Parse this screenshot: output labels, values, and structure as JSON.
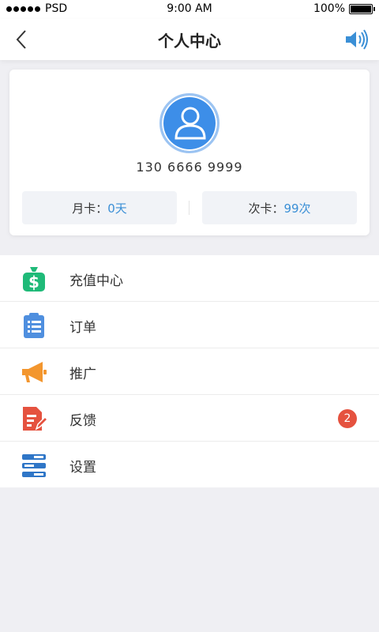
{
  "status_bar": {
    "carrier": "PSD",
    "time": "9:00 AM",
    "battery": "100%",
    "battery_level": 1.0
  },
  "nav": {
    "title": "个人中心",
    "back_icon": "chevron-left-icon",
    "right_icon": "speaker-icon"
  },
  "profile": {
    "avatar_icon": "user-icon",
    "phone": "130 6666 9999",
    "monthly_label": "月卡：",
    "monthly_value": "0天",
    "count_label": "次卡：",
    "count_value": "99次"
  },
  "menu": {
    "items": [
      {
        "label": "充值中心",
        "icon": "money-bag-icon",
        "color": "#1fba78"
      },
      {
        "label": "订单",
        "icon": "clipboard-icon",
        "color": "#4f8fdf"
      },
      {
        "label": "推广",
        "icon": "megaphone-icon",
        "color": "#f3962e"
      },
      {
        "label": "反馈",
        "icon": "edit-document-icon",
        "color": "#e5523f",
        "badge": "2"
      },
      {
        "label": "设置",
        "icon": "settings-list-icon",
        "color": "#2f76c7"
      }
    ]
  },
  "colors": {
    "accent": "#3a8fd6",
    "background": "#efeff3",
    "badge": "#e5523f"
  }
}
